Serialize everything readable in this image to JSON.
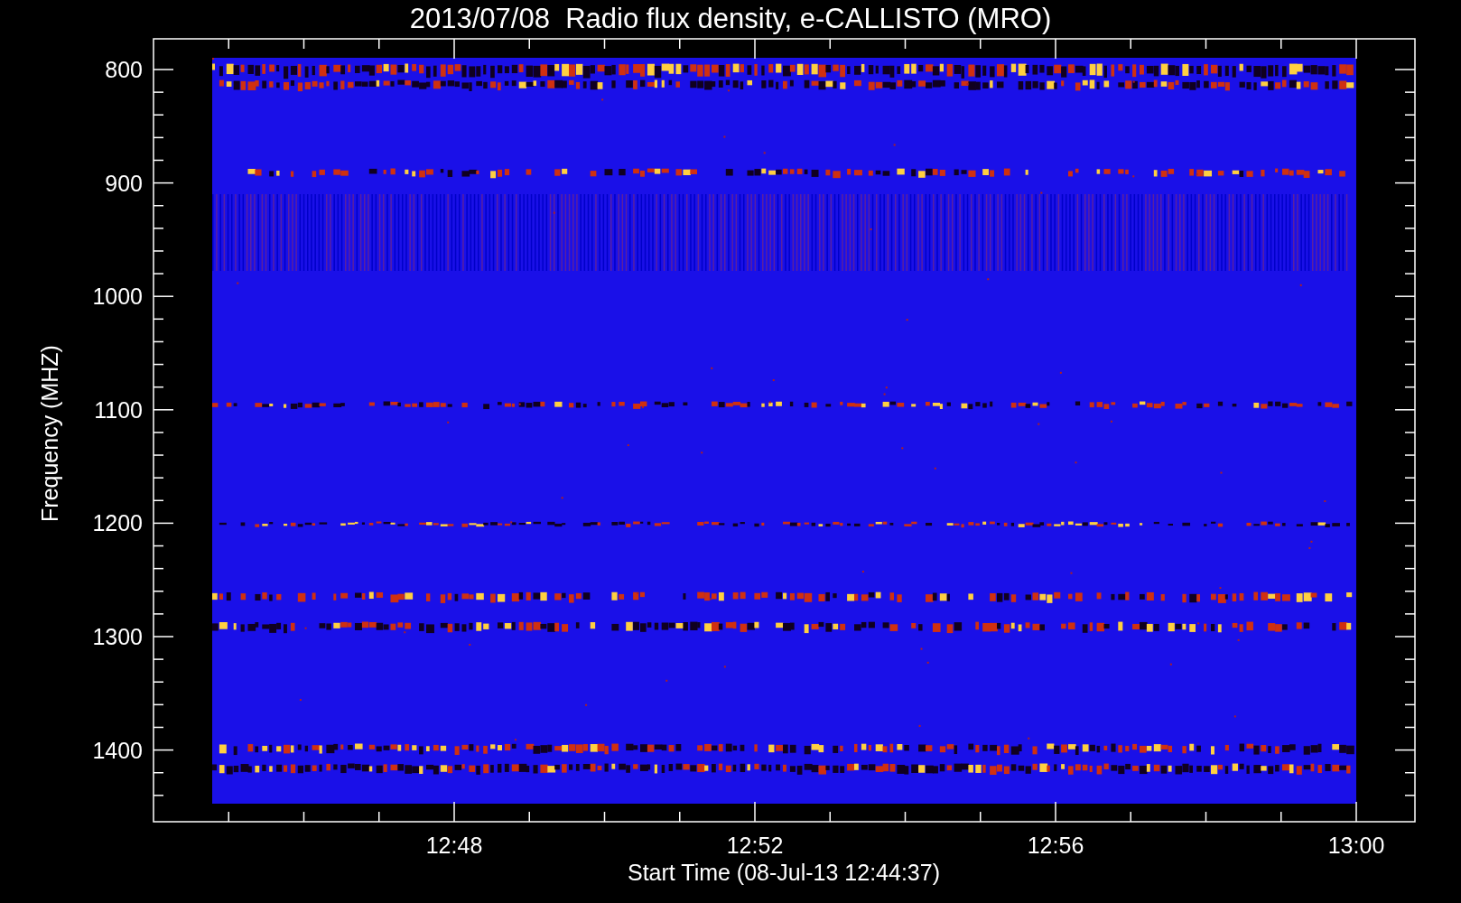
{
  "title": "2013/07/08  Radio flux density, e-CALLISTO (MRO)",
  "y_axis": {
    "label": "Frequency (MHZ)",
    "ticks": [
      "800",
      "900",
      "1000",
      "1100",
      "1200",
      "1300",
      "1400"
    ]
  },
  "x_axis": {
    "label": "Start Time (08-Jul-13 12:44:37)",
    "ticks": [
      "12:48",
      "12:52",
      "12:56",
      "13:00"
    ]
  }
}
